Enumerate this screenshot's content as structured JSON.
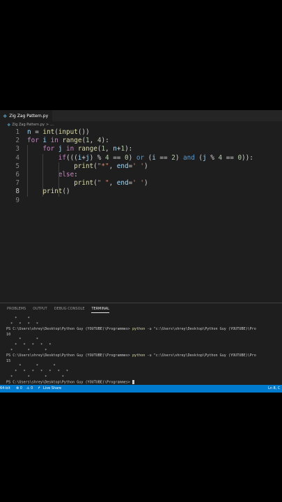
{
  "tab": {
    "filename": "Zig Zag Pattern.py"
  },
  "breadcrumb": {
    "file": "Zig Zag Pattern.py",
    "sep": ">",
    "rest": "..."
  },
  "editor": {
    "line_numbers": [
      "1",
      "2",
      "3",
      "4",
      "5",
      "6",
      "7",
      "8",
      "9"
    ],
    "active_line": "8",
    "lines": [
      [
        {
          "t": "n",
          "c": "var"
        },
        {
          "t": " = ",
          "c": ""
        },
        {
          "t": "int",
          "c": "fn"
        },
        {
          "t": "(",
          "c": ""
        },
        {
          "t": "input",
          "c": "fn"
        },
        {
          "t": "())",
          "c": ""
        }
      ],
      [
        {
          "t": "for",
          "c": "ctl"
        },
        {
          "t": " ",
          "c": ""
        },
        {
          "t": "i",
          "c": "var"
        },
        {
          "t": " ",
          "c": ""
        },
        {
          "t": "in",
          "c": "ctl"
        },
        {
          "t": " ",
          "c": ""
        },
        {
          "t": "range",
          "c": "fn"
        },
        {
          "t": "(",
          "c": ""
        },
        {
          "t": "1",
          "c": "num"
        },
        {
          "t": ", ",
          "c": ""
        },
        {
          "t": "4",
          "c": "num"
        },
        {
          "t": "):",
          "c": ""
        }
      ],
      [
        {
          "t": "    ",
          "c": ""
        },
        {
          "t": "for",
          "c": "ctl"
        },
        {
          "t": " ",
          "c": ""
        },
        {
          "t": "j",
          "c": "var"
        },
        {
          "t": " ",
          "c": ""
        },
        {
          "t": "in",
          "c": "ctl"
        },
        {
          "t": " ",
          "c": ""
        },
        {
          "t": "range",
          "c": "fn"
        },
        {
          "t": "(",
          "c": ""
        },
        {
          "t": "1",
          "c": "num"
        },
        {
          "t": ", ",
          "c": ""
        },
        {
          "t": "n",
          "c": "var"
        },
        {
          "t": "+",
          "c": ""
        },
        {
          "t": "1",
          "c": "num"
        },
        {
          "t": "):",
          "c": ""
        }
      ],
      [
        {
          "t": "        ",
          "c": ""
        },
        {
          "t": "if",
          "c": "ctl"
        },
        {
          "t": "(((",
          "c": ""
        },
        {
          "t": "i",
          "c": "var"
        },
        {
          "t": "+",
          "c": ""
        },
        {
          "t": "j",
          "c": "var"
        },
        {
          "t": ") % ",
          "c": ""
        },
        {
          "t": "4",
          "c": "num"
        },
        {
          "t": " == ",
          "c": ""
        },
        {
          "t": "0",
          "c": "num"
        },
        {
          "t": ") ",
          "c": ""
        },
        {
          "t": "or",
          "c": "kw"
        },
        {
          "t": " (",
          "c": ""
        },
        {
          "t": "i",
          "c": "var"
        },
        {
          "t": " == ",
          "c": ""
        },
        {
          "t": "2",
          "c": "num"
        },
        {
          "t": ") ",
          "c": ""
        },
        {
          "t": "and",
          "c": "kw"
        },
        {
          "t": " (",
          "c": ""
        },
        {
          "t": "j",
          "c": "var"
        },
        {
          "t": " % ",
          "c": ""
        },
        {
          "t": "4",
          "c": "num"
        },
        {
          "t": " == ",
          "c": ""
        },
        {
          "t": "0",
          "c": "num"
        },
        {
          "t": ")):",
          "c": ""
        }
      ],
      [
        {
          "t": "            ",
          "c": ""
        },
        {
          "t": "print",
          "c": "fn"
        },
        {
          "t": "(",
          "c": ""
        },
        {
          "t": "\"*\"",
          "c": "str"
        },
        {
          "t": ", ",
          "c": ""
        },
        {
          "t": "end",
          "c": "var"
        },
        {
          "t": "=",
          "c": ""
        },
        {
          "t": "' '",
          "c": "str"
        },
        {
          "t": ")",
          "c": ""
        }
      ],
      [
        {
          "t": "        ",
          "c": ""
        },
        {
          "t": "else",
          "c": "ctl"
        },
        {
          "t": ":",
          "c": ""
        }
      ],
      [
        {
          "t": "            ",
          "c": ""
        },
        {
          "t": "print",
          "c": "fn"
        },
        {
          "t": "(",
          "c": ""
        },
        {
          "t": "\" \"",
          "c": "str"
        },
        {
          "t": ", ",
          "c": ""
        },
        {
          "t": "end",
          "c": "var"
        },
        {
          "t": "=",
          "c": ""
        },
        {
          "t": "' '",
          "c": "str"
        },
        {
          "t": ")",
          "c": ""
        }
      ],
      [
        {
          "t": "    ",
          "c": ""
        },
        {
          "t": "print",
          "c": "fn"
        },
        {
          "t": "()",
          "c": ""
        }
      ],
      []
    ]
  },
  "panel": {
    "tabs": [
      {
        "label": "PROBLEMS",
        "active": false
      },
      {
        "label": "OUTPUT",
        "active": false
      },
      {
        "label": "DEBUG CONSOLE",
        "active": false
      },
      {
        "label": "TERMINAL",
        "active": true
      }
    ]
  },
  "terminal": {
    "lines": [
      {
        "text": "    *     *"
      },
      {
        "text": "  *   *   *   *"
      },
      {
        "text": "PS C:\\Users\\shrey\\Desktop\\Python Guy (YOUTUBE)\\Programmes> ",
        "cmd": "python",
        "rest": " -u \"c:\\Users\\shrey\\Desktop\\Python Guy (YOUTUBE)\\Pro"
      },
      {
        "text": "10"
      },
      {
        "text": "      *       *"
      },
      {
        "text": "    *   *   *   *   *"
      },
      {
        "text": "  *       *       *"
      },
      {
        "text": "PS C:\\Users\\shrey\\Desktop\\Python Guy (YOUTUBE)\\Programmes> ",
        "cmd": "python",
        "rest": " -u \"c:\\Users\\shrey\\Desktop\\Python Guy (YOUTUBE)\\Pro"
      },
      {
        "text": "15"
      },
      {
        "text": "      *       *       *"
      },
      {
        "text": "    *   *   *   *   *   *   *"
      },
      {
        "text": "  *       *       *       *"
      },
      {
        "text": "PS C:\\Users\\shrey\\Desktop\\Python Guy (YOUTUBE)\\Programmes> ",
        "cursor": true
      }
    ]
  },
  "statusbar": {
    "python": "64-bit",
    "errors": "⊗ 0",
    "warnings": "⚠ 0",
    "liveshare": "Live Share",
    "position": "Ln 8, C"
  },
  "colors": {
    "accent": "#007acc",
    "editor_bg": "#1e1e1e"
  }
}
